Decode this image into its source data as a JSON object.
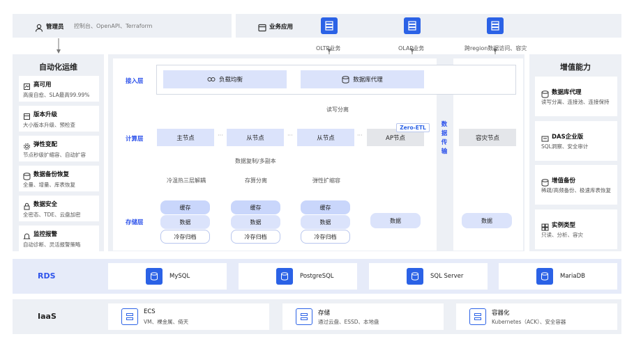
{
  "top": {
    "admin": {
      "label": "管理员",
      "desc": "控制台、OpenAPI、Terraform"
    },
    "biz": {
      "label": "业务应用"
    },
    "apps": [
      {
        "label": "OLTP业务"
      },
      {
        "label": "OLAP业务"
      },
      {
        "label": "跨region数据访问、容灾"
      }
    ]
  },
  "left": {
    "title": "自动化运维",
    "items": [
      {
        "title": "高可用",
        "desc": "高度自愈、SLA最高99.99%"
      },
      {
        "title": "版本升级",
        "desc": "大小版本升级、预检查"
      },
      {
        "title": "弹性变配",
        "desc": "节点秒级扩缩容、自动扩容"
      },
      {
        "title": "数据备份恢复",
        "desc": "全量、增量、库表恢复"
      },
      {
        "title": "数据安全",
        "desc": "全密态、TDE、云盘加密"
      },
      {
        "title": "监控报警",
        "desc": "自动诊断、灵活报警策略"
      }
    ]
  },
  "right": {
    "title": "增值能力",
    "items": [
      {
        "title": "数据库代理",
        "desc": "读写分离、连接池、连接保持"
      },
      {
        "title": "DAS企业版",
        "desc": "SQL洞察、安全审计"
      },
      {
        "title": "增值备份",
        "desc": "稀疏/高频备份、极速库表恢复"
      },
      {
        "title": "实例类型",
        "desc": "只读、分析、容灾"
      }
    ]
  },
  "center": {
    "layers": {
      "access": "接入层",
      "compute": "计算层",
      "storage": "存储层"
    },
    "lb": "负载均衡",
    "proxy": "数据库代理",
    "rw_split": "读写分离",
    "nodes": {
      "primary": "主节点",
      "secondary1": "从节点",
      "secondary2": "从节点",
      "ap": "AP节点",
      "dr": "容灾节点",
      "ellipsis": "···"
    },
    "zero_etl": "Zero-ETL",
    "data_transfer": [
      "数",
      "据",
      "传",
      "输"
    ],
    "replication": "数据复制/多副本",
    "storage_labels": [
      "冷温热三层解耦",
      "存算分离",
      "弹性扩缩容"
    ],
    "cyl": {
      "cache": "缓存",
      "data": "数据",
      "cold": "冷存归档"
    }
  },
  "rds": {
    "label": "RDS",
    "engines": [
      {
        "name": "MySQL"
      },
      {
        "name": "PostgreSQL"
      },
      {
        "name": "SQL Server"
      },
      {
        "name": "MariaDB"
      }
    ]
  },
  "iaas": {
    "label": "IaaS",
    "items": [
      {
        "title": "ECS",
        "desc": "VM、裸金属、倚天"
      },
      {
        "title": "存储",
        "desc": "通过云盘、ESSD、本地盘"
      },
      {
        "title": "容器化",
        "desc": "Kubernetes（ACK）、安全容器"
      }
    ]
  },
  "colors": {
    "accent": "#2b62e6",
    "node": "#dbe3fb",
    "panel": "#edf0f5"
  }
}
